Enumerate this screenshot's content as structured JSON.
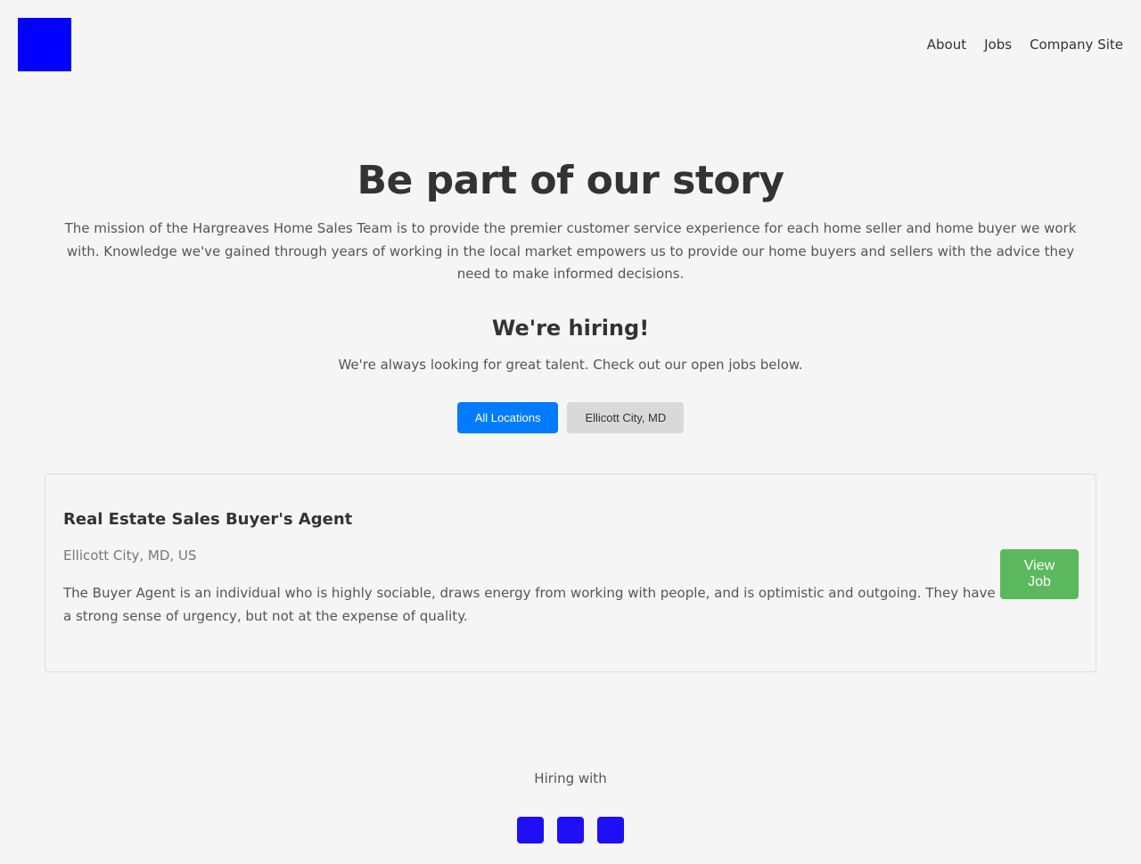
{
  "header": {
    "logo_icon": "logo-icon",
    "nav": [
      "About",
      "Jobs",
      "Company Site"
    ]
  },
  "hero": {
    "title": "Be part of our story",
    "mission": "The mission of the Hargreaves Home Sales Team is to provide the premier customer service experience for each home seller and home buyer we work with. Knowledge we've gained through years of working in the local market empowers us to provide our home buyers and sellers with the advice they need to make informed decisions.",
    "subtitle": "We're hiring!",
    "lookout": "We're always looking for great talent. Check out our open jobs below."
  },
  "filters": {
    "all": "All Locations",
    "ellicott": "Ellicott City, MD",
    "active_color": "#007bff"
  },
  "job": {
    "title": "Real Estate Sales Buyer's Agent",
    "location": "Ellicott City, MD, US",
    "description": "The Buyer Agent is an individual who is highly sociable, draws energy from working with people, and is optimistic and outgoing. They have a strong sense of urgency, but not at the expense of quality.",
    "button": "View Job",
    "button_color": "#5cb85c"
  },
  "footer": {
    "hiring": "Hiring with",
    "social_icons": [
      "social-icon-1",
      "social-icon-2",
      "social-icon-3"
    ]
  },
  "colors": {
    "logo": "#0000ff",
    "social": "#1e0ff5"
  }
}
